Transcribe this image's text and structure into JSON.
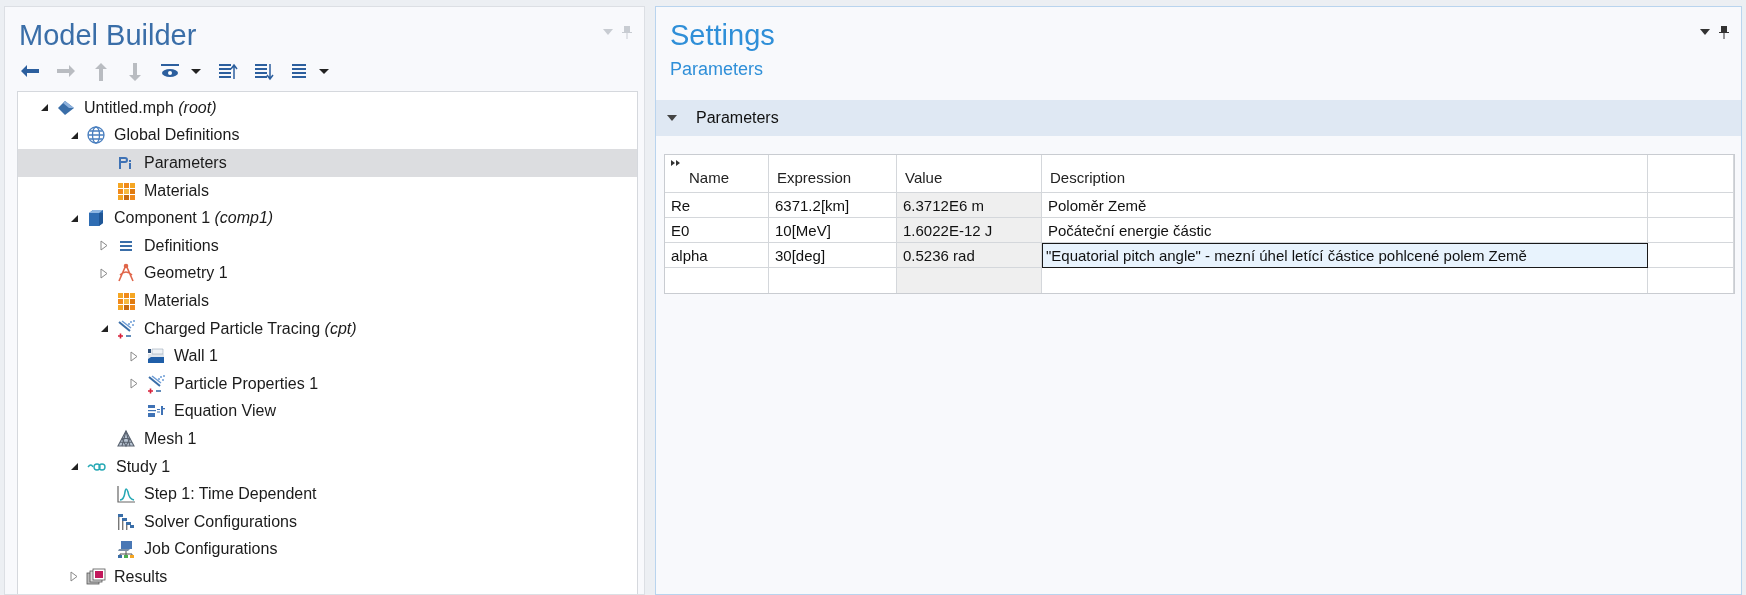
{
  "model_builder": {
    "title": "Model Builder",
    "toolbar": [
      {
        "kind": "back",
        "disabled": false
      },
      {
        "kind": "forward",
        "disabled": true
      },
      {
        "kind": "up",
        "disabled": true
      },
      {
        "kind": "down",
        "disabled": true
      },
      {
        "kind": "show",
        "disabled": false
      },
      {
        "kind": "dropdown",
        "disabled": false
      },
      {
        "kind": "collapse",
        "disabled": false
      },
      {
        "kind": "expand",
        "disabled": false
      },
      {
        "kind": "list",
        "disabled": false
      },
      {
        "kind": "dropdown",
        "disabled": false
      }
    ],
    "tree": [
      {
        "label": "Untitled.mph",
        "suffix": "(root)",
        "kind": "model",
        "expanded": true,
        "selected": false,
        "children": [
          {
            "label": "Global Definitions",
            "kind": "globe",
            "expanded": true,
            "selected": false,
            "children": [
              {
                "label": "Parameters",
                "kind": "params",
                "selected": true
              },
              {
                "label": "Materials",
                "kind": "materials",
                "selected": false
              }
            ]
          },
          {
            "label": "Component 1",
            "suffix": "(comp1)",
            "kind": "component",
            "expanded": true,
            "selected": false,
            "children": [
              {
                "label": "Definitions",
                "kind": "definitions",
                "expanded": false,
                "selected": false
              },
              {
                "label": "Geometry 1",
                "kind": "geometry",
                "expanded": false,
                "selected": false
              },
              {
                "label": "Materials",
                "kind": "materials",
                "selected": false
              },
              {
                "label": "Charged Particle Tracing",
                "suffix": "(cpt)",
                "kind": "particles",
                "expanded": true,
                "selected": false,
                "children": [
                  {
                    "label": "Wall 1",
                    "kind": "wall",
                    "expanded": false,
                    "selected": false
                  },
                  {
                    "label": "Particle Properties 1",
                    "kind": "particles",
                    "expanded": false,
                    "selected": false
                  },
                  {
                    "label": "Equation View",
                    "kind": "equation",
                    "selected": false
                  }
                ]
              },
              {
                "label": "Mesh 1",
                "kind": "mesh",
                "selected": false
              }
            ]
          },
          {
            "label": "Study 1",
            "kind": "study",
            "expanded": true,
            "selected": false,
            "children": [
              {
                "label": "Step 1: Time Dependent",
                "kind": "step",
                "selected": false
              },
              {
                "label": "Solver Configurations",
                "kind": "solver",
                "selected": false
              },
              {
                "label": "Job Configurations",
                "kind": "job",
                "selected": false
              }
            ]
          },
          {
            "label": "Results",
            "kind": "results",
            "expanded": false,
            "selected": false
          }
        ]
      }
    ]
  },
  "settings": {
    "title": "Settings",
    "subtitle": "Parameters",
    "section": {
      "title": "Parameters",
      "expanded": true,
      "table": {
        "columns": [
          "Name",
          "Expression",
          "Value",
          "Description"
        ],
        "rows": [
          {
            "cells": [
              "Re",
              "6371.2[km]",
              "6.3712E6 m",
              "Poloměr Země"
            ],
            "editing": false
          },
          {
            "cells": [
              "E0",
              "10[MeV]",
              "1.6022E-12 J",
              "Počáteční energie částic"
            ],
            "editing": false
          },
          {
            "cells": [
              "alpha",
              "30[deg]",
              "0.5236 rad",
              "\"Equatorial pitch angle\" - mezní úhel letící částice pohlcené polem Země"
            ],
            "editing": true
          }
        ]
      }
    }
  }
}
